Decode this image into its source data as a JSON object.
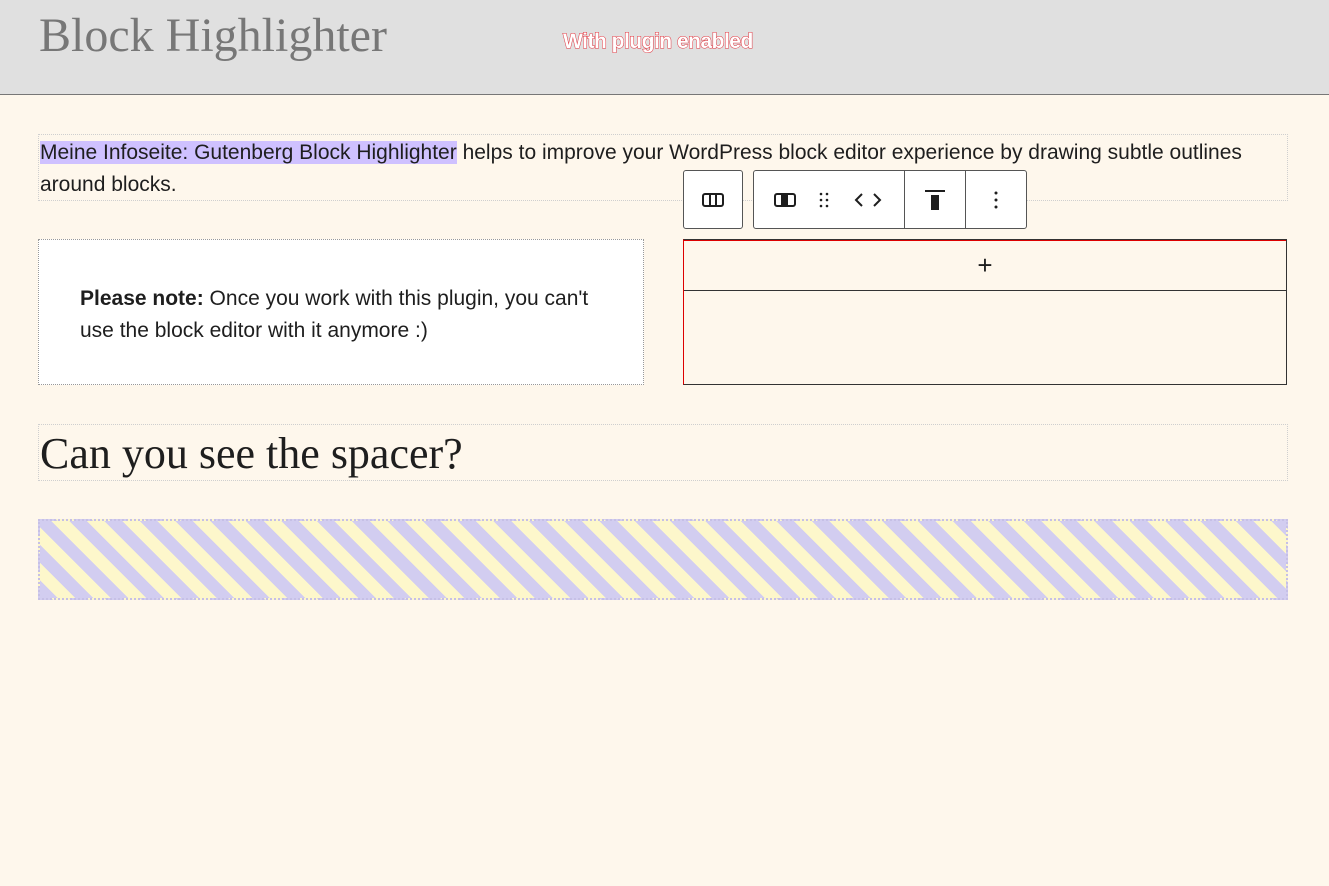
{
  "header": {
    "site_title": "Block Highlighter",
    "annotation": "With plugin enabled"
  },
  "content": {
    "paragraph": {
      "highlight": "Meine Infoseite: Gutenberg Block Highlighter",
      "rest": " helps to improve your WordPress block editor experience by drawing subtle outlines around blocks."
    },
    "column1": {
      "bold": "Please note:",
      "text": " Once you work with this plugin, you can't use the block editor with it anymore :)"
    },
    "column2": {
      "appender": "+"
    },
    "heading": "Can you see the spacer?"
  }
}
